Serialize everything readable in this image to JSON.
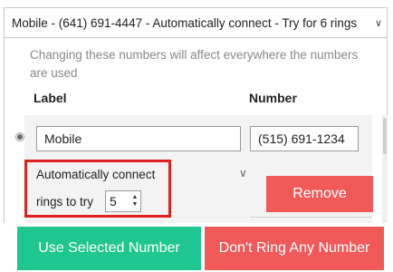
{
  "dropdown": {
    "selected": "Mobile - (641) 691-4447 - Automatically connect - Try for 6 rings",
    "arrow_icon": "chevron-down-icon"
  },
  "notice": "Changing these numbers will affect everywhere the numbers are used",
  "columns": {
    "label": "Label",
    "number": "Number"
  },
  "row": {
    "label_value": "Mobile",
    "number_value": "(515) 691-1234",
    "connect_mode": "Automatically connect",
    "rings_label": "rings to try",
    "rings_value": "5",
    "remove_label": "Remove"
  },
  "actions": {
    "use_selected": "Use Selected Number",
    "dont_ring": "Don't Ring Any Number"
  },
  "colors": {
    "green": "#1fc68f",
    "red": "#f25a5a",
    "highlight": "#e02020"
  }
}
